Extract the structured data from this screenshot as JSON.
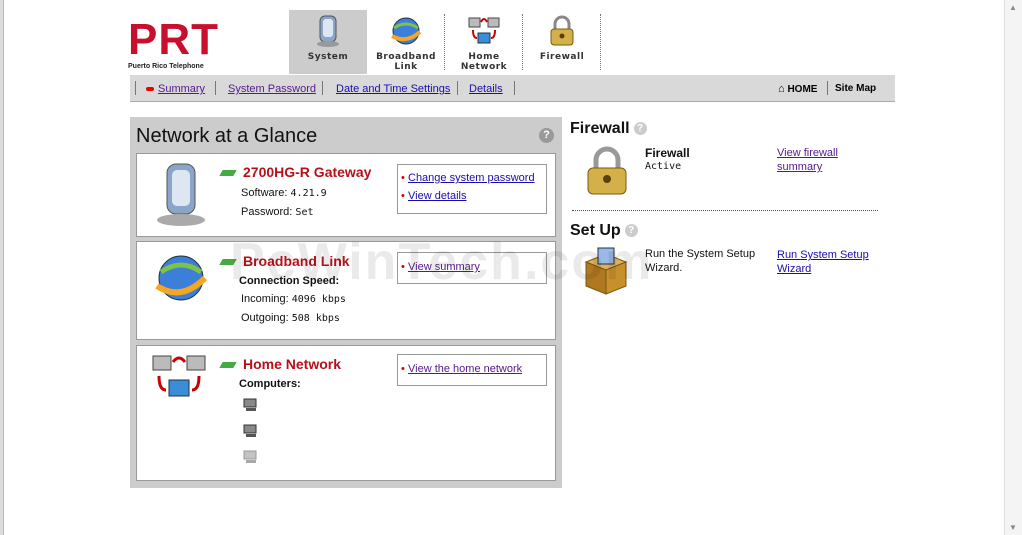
{
  "logo": {
    "letters": "PRT",
    "subtitle": "Puerto Rico Telephone"
  },
  "nav": {
    "tabs": [
      {
        "line1": "System",
        "line2": ""
      },
      {
        "line1": "Broadband",
        "line2": "Link"
      },
      {
        "line1": "Home",
        "line2": "Network"
      },
      {
        "line1": "Firewall",
        "line2": ""
      }
    ]
  },
  "subnav": {
    "summary": "Summary",
    "system_password": "System Password",
    "date_time": "Date and Time Settings",
    "details": "Details",
    "home": "HOME",
    "site_map": "Site Map"
  },
  "glance": {
    "title": "Network at a Glance",
    "help": "?",
    "gateway": {
      "name": "2700HG-R Gateway",
      "software_label": "Software:",
      "software_value": "4.21.9",
      "password_label": "Password:",
      "password_value": "Set",
      "links": [
        "Change system password",
        "View details"
      ]
    },
    "broadband": {
      "name": "Broadband Link",
      "speed_label": "Connection Speed:",
      "incoming_label": "Incoming:",
      "incoming_value": "4096 kbps",
      "outgoing_label": "Outgoing:",
      "outgoing_value": "508 kbps",
      "links": [
        "View summary"
      ]
    },
    "home_network": {
      "name": "Home Network",
      "computers_label": "Computers:",
      "links": [
        "View the home network"
      ]
    }
  },
  "firewall": {
    "title": "Firewall",
    "help": "?",
    "label": "Firewall",
    "status": "Active",
    "link": "View firewall summary"
  },
  "setup": {
    "title": "Set Up",
    "help": "?",
    "text": "Run the System Setup Wizard.",
    "link": "Run System Setup Wizard"
  },
  "watermark": "PcWinTech.com",
  "colors": {
    "accent_red": "#b5111b",
    "link": "#1a0dab",
    "visited": "#551a8b",
    "panel": "#cccccc"
  }
}
